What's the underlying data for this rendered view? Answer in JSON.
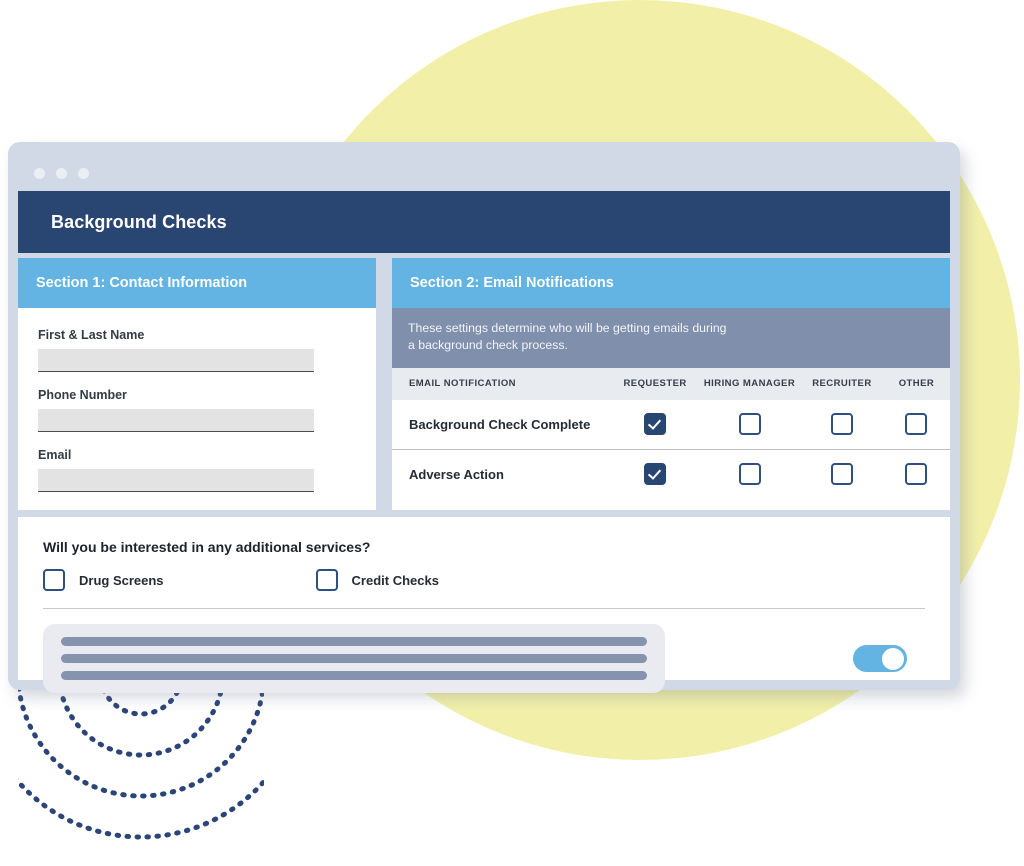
{
  "window": {
    "chrome_dots": [
      "dot-1",
      "dot-2",
      "dot-3"
    ],
    "app_title": "Background Checks"
  },
  "section1": {
    "header": "Section 1: Contact Information",
    "fields": [
      {
        "label": "First & Last Name",
        "value": "",
        "placeholder": ""
      },
      {
        "label": "Phone Number",
        "value": "",
        "placeholder": ""
      },
      {
        "label": "Email",
        "value": "",
        "placeholder": ""
      }
    ]
  },
  "section2": {
    "header": "Section 2: Email Notifications",
    "note_line1": "These settings determine who will be getting emails during",
    "note_line2": "a background check process.",
    "columns": [
      "EMAIL NOTIFICATION",
      "REQUESTER",
      "HIRING MANAGER",
      "RECRUITER",
      "OTHER"
    ],
    "rows": [
      {
        "name": "Background Check Complete",
        "requester": true,
        "hiring_manager": false,
        "recruiter": false,
        "other": false
      },
      {
        "name": "Adverse Action",
        "requester": true,
        "hiring_manager": false,
        "recruiter": false,
        "other": false
      }
    ]
  },
  "additional_services": {
    "question": "Will you be interested in any additional services?",
    "options": [
      {
        "label": "Drug Screens",
        "checked": false
      },
      {
        "label": "Credit Checks",
        "checked": false
      }
    ],
    "toggle": {
      "state": "on"
    },
    "skeleton_bars": 3
  },
  "colors": {
    "navy": "#294672",
    "sky": "#63b3e3",
    "slate": "#7f8fac",
    "window_chrome": "#d2d9e6",
    "table_header": "#e8ebf0",
    "input_fill": "#e3e3e3",
    "yellow_blob": "#f2f0a8",
    "skeleton_bar": "#8593ae",
    "skeleton_card": "#e9ebf0"
  }
}
